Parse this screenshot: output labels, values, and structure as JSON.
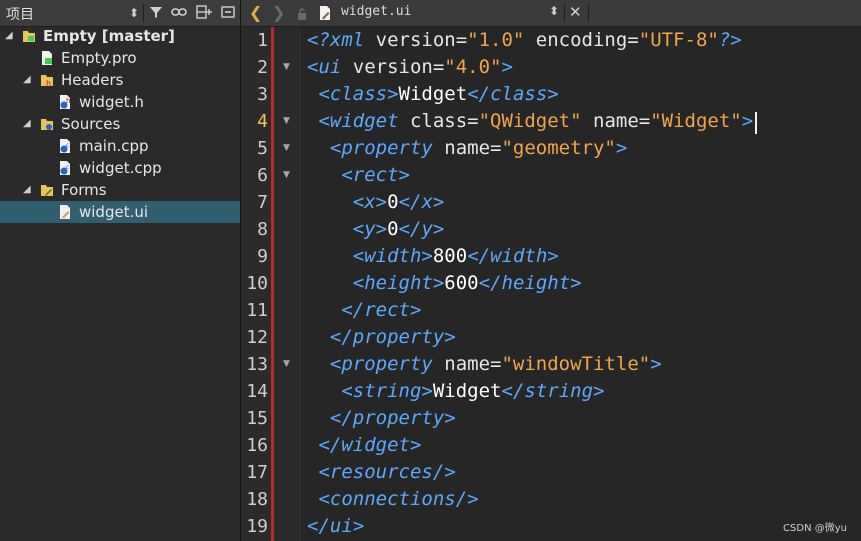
{
  "project_panel": {
    "title": "项目",
    "tree": [
      {
        "label": "Empty [master]",
        "bold": true,
        "icon": "qt-project-icon",
        "expanded": true
      },
      {
        "label": "Empty.pro",
        "icon": "pro-file-icon"
      },
      {
        "label": "Headers",
        "icon": "headers-folder-icon",
        "expanded": true
      },
      {
        "label": "widget.h",
        "icon": "header-file-icon"
      },
      {
        "label": "Sources",
        "icon": "sources-folder-icon",
        "expanded": true
      },
      {
        "label": "main.cpp",
        "icon": "cpp-file-icon"
      },
      {
        "label": "widget.cpp",
        "icon": "cpp-file-icon"
      },
      {
        "label": "Forms",
        "icon": "forms-folder-icon",
        "expanded": true
      },
      {
        "label": "widget.ui",
        "icon": "ui-file-icon",
        "selected": true
      }
    ]
  },
  "editor": {
    "file_name": "widget.ui",
    "current_line": 4,
    "line_numbers": [
      "1",
      "2",
      "3",
      "4",
      "5",
      "6",
      "7",
      "8",
      "9",
      "10",
      "11",
      "12",
      "13",
      "14",
      "15",
      "16",
      "17",
      "18",
      "19"
    ],
    "fold_lines": [
      2,
      4,
      5,
      6,
      13
    ]
  },
  "code": [
    [
      [
        "pi",
        "<?xml "
      ],
      [
        "at",
        "version="
      ],
      [
        "vl",
        "\"1.0\""
      ],
      [
        "at",
        " encoding="
      ],
      [
        "vl",
        "\"UTF-8\""
      ],
      [
        "pi",
        "?>"
      ]
    ],
    [
      [
        "tg",
        "<ui"
      ],
      [
        "at",
        " version="
      ],
      [
        "vl",
        "\"4.0\""
      ],
      [
        "br",
        ">"
      ]
    ],
    [
      [
        "tx",
        " "
      ],
      [
        "tg",
        "<class"
      ],
      [
        "br",
        ">"
      ],
      [
        "tx",
        "Widget"
      ],
      [
        "tg",
        "</class"
      ],
      [
        "br",
        ">"
      ]
    ],
    [
      [
        "tx",
        " "
      ],
      [
        "tg",
        "<widget"
      ],
      [
        "at",
        " class="
      ],
      [
        "vl",
        "\"QWidget\""
      ],
      [
        "at",
        " name="
      ],
      [
        "vl",
        "\"Widget\""
      ],
      [
        "br",
        ">"
      ]
    ],
    [
      [
        "tx",
        "  "
      ],
      [
        "tg",
        "<property"
      ],
      [
        "at",
        " name="
      ],
      [
        "vl",
        "\"geometry\""
      ],
      [
        "br",
        ">"
      ]
    ],
    [
      [
        "tx",
        "   "
      ],
      [
        "tg",
        "<rect"
      ],
      [
        "br",
        ">"
      ]
    ],
    [
      [
        "tx",
        "    "
      ],
      [
        "tg",
        "<x"
      ],
      [
        "br",
        ">"
      ],
      [
        "tx",
        "0"
      ],
      [
        "tg",
        "</x"
      ],
      [
        "br",
        ">"
      ]
    ],
    [
      [
        "tx",
        "    "
      ],
      [
        "tg",
        "<y"
      ],
      [
        "br",
        ">"
      ],
      [
        "tx",
        "0"
      ],
      [
        "tg",
        "</y"
      ],
      [
        "br",
        ">"
      ]
    ],
    [
      [
        "tx",
        "    "
      ],
      [
        "tg",
        "<width"
      ],
      [
        "br",
        ">"
      ],
      [
        "tx",
        "800"
      ],
      [
        "tg",
        "</width"
      ],
      [
        "br",
        ">"
      ]
    ],
    [
      [
        "tx",
        "    "
      ],
      [
        "tg",
        "<height"
      ],
      [
        "br",
        ">"
      ],
      [
        "tx",
        "600"
      ],
      [
        "tg",
        "</height"
      ],
      [
        "br",
        ">"
      ]
    ],
    [
      [
        "tx",
        "   "
      ],
      [
        "tg",
        "</rect"
      ],
      [
        "br",
        ">"
      ]
    ],
    [
      [
        "tx",
        "  "
      ],
      [
        "tg",
        "</property"
      ],
      [
        "br",
        ">"
      ]
    ],
    [
      [
        "tx",
        "  "
      ],
      [
        "tg",
        "<property"
      ],
      [
        "at",
        " name="
      ],
      [
        "vl",
        "\"windowTitle\""
      ],
      [
        "br",
        ">"
      ]
    ],
    [
      [
        "tx",
        "   "
      ],
      [
        "tg",
        "<string"
      ],
      [
        "br",
        ">"
      ],
      [
        "tx",
        "Widget"
      ],
      [
        "tg",
        "</string"
      ],
      [
        "br",
        ">"
      ]
    ],
    [
      [
        "tx",
        "  "
      ],
      [
        "tg",
        "</property"
      ],
      [
        "br",
        ">"
      ]
    ],
    [
      [
        "tx",
        " "
      ],
      [
        "tg",
        "</widget"
      ],
      [
        "br",
        ">"
      ]
    ],
    [
      [
        "tx",
        " "
      ],
      [
        "tg",
        "<resources/"
      ],
      [
        "br",
        ">"
      ]
    ],
    [
      [
        "tx",
        " "
      ],
      [
        "tg",
        "<connections/"
      ],
      [
        "br",
        ">"
      ]
    ],
    [
      [
        "tg",
        "</ui"
      ],
      [
        "br",
        ">"
      ]
    ]
  ],
  "watermark": "CSDN @微yu",
  "colors": {
    "selection": "#2f5f70",
    "tag": "#5aa9ff",
    "value": "#f2a44c",
    "change_bar": "#c0262b",
    "current_line_number": "#f0c85a"
  }
}
